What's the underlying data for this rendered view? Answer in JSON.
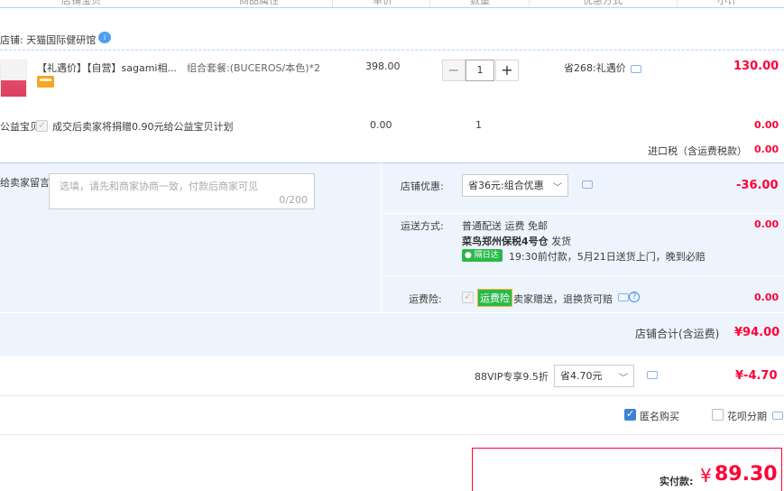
{
  "header": {
    "col_store": "店铺宝贝",
    "col_attr": "商品属性",
    "col_price": "单价",
    "col_qty": "数量",
    "col_promo": "优惠方式",
    "col_subtotal": "小计"
  },
  "store": {
    "label": "店铺:",
    "name": "天猫国际健研馆",
    "badge": "i"
  },
  "item": {
    "title": "【礼遇价】【自营】sagami相...",
    "attr": "组合套餐:(BUCEROS/本色)*2",
    "price": "398.00",
    "qty": "1",
    "minus": "−",
    "plus": "+",
    "promo": "省268:礼遇价",
    "subtotal": "130.00"
  },
  "charity": {
    "label": "公益宝贝",
    "text": "成交后卖家将捐赠0.90元给公益宝贝计划",
    "price": "0.00",
    "qty": "1",
    "subtotal": "0.00"
  },
  "tax": {
    "label": "进口税（含运费税款）",
    "value": "0.00"
  },
  "message": {
    "label": "给卖家留言:",
    "placeholder": "选填，请先和商家协商一致，付款后商家可见",
    "count": "0/200"
  },
  "discount": {
    "label": "店铺优惠:",
    "selected": "省36元:组合优惠",
    "value": "-36.00"
  },
  "shipping": {
    "label": "运送方式:",
    "method": "普通配送 运费 免邮",
    "warehouse": "菜鸟郑州保税4号仓",
    "ship_text": "发货",
    "badge": "隔日达",
    "eta": "19:30前付款，5月21日送货上门，晚到必赔",
    "value": "0.00"
  },
  "insurance": {
    "label": "运费险:",
    "badge": "运费险",
    "text": "卖家赠送，退换货可赔",
    "value": "0.00"
  },
  "store_total": {
    "label": "店铺合计(含运费)",
    "value": "¥94.00"
  },
  "vip": {
    "label": "88VIP专享9.5折",
    "selected": "省4.70元",
    "value": "¥-4.70"
  },
  "options": {
    "anonymous": "匿名购买",
    "installment": "花呗分期"
  },
  "pay": {
    "label": "实付款:",
    "currency": "¥",
    "amount": "89.30"
  },
  "colors": {
    "accent_red": "#ff0036",
    "band_blue": "#eef4fd",
    "link_blue": "#3b82d6"
  }
}
